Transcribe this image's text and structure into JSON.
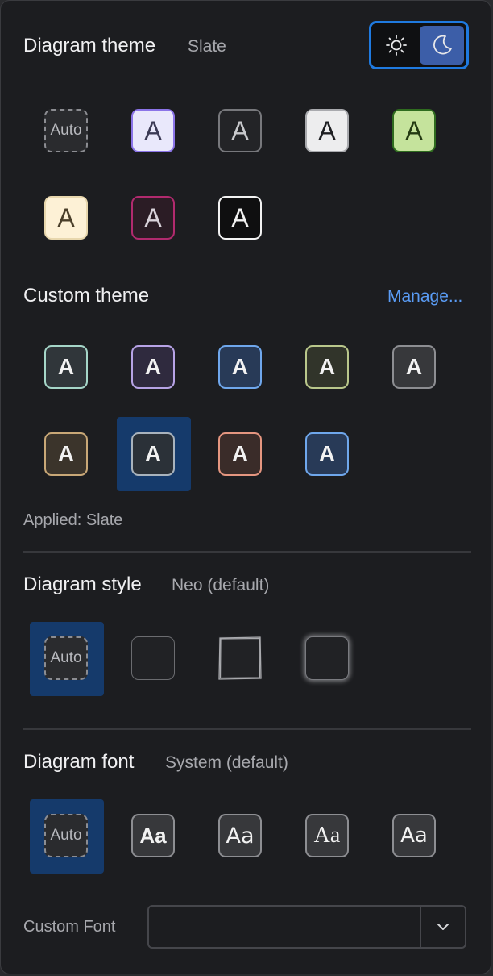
{
  "theme": {
    "title": "Diagram theme",
    "current": "Slate",
    "mode_toggle": {
      "light_icon": "sun-icon",
      "dark_icon": "moon-icon",
      "active": "dark"
    },
    "preset_tiles": [
      {
        "label": "Auto"
      },
      {
        "label": "A"
      },
      {
        "label": "A"
      },
      {
        "label": "A"
      },
      {
        "label": "A"
      },
      {
        "label": "A"
      },
      {
        "label": "A"
      },
      {
        "label": "A"
      }
    ]
  },
  "custom_theme": {
    "title": "Custom theme",
    "manage_label": "Manage...",
    "tiles": [
      {
        "label": "A"
      },
      {
        "label": "A"
      },
      {
        "label": "A"
      },
      {
        "label": "A"
      },
      {
        "label": "A"
      },
      {
        "label": "A"
      },
      {
        "label": "A"
      },
      {
        "label": "A"
      },
      {
        "label": "A"
      }
    ],
    "selected_index": 6,
    "applied_text": "Applied: Slate"
  },
  "style": {
    "title": "Diagram style",
    "current": "Neo (default)",
    "auto_label": "Auto"
  },
  "font": {
    "title": "Diagram font",
    "current": "System (default)",
    "auto_label": "Auto",
    "samples": [
      "Aa",
      "Aa",
      "Aa",
      "Aa"
    ],
    "custom_label": "Custom Font",
    "custom_value": ""
  },
  "colors": {
    "accent": "#1f7ae0",
    "selected_bg": "#153a6b",
    "link": "#5a9cf5"
  }
}
